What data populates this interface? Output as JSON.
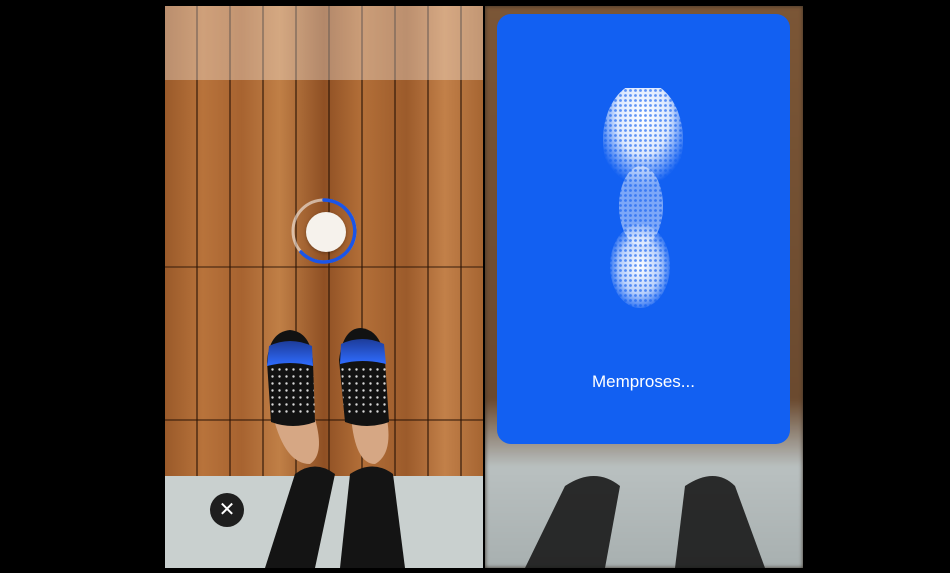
{
  "scan_panel": {
    "status_text": "Memproses...",
    "card_color": "#1260f2"
  },
  "camera_panel": {
    "close_icon_glyph": "✕",
    "progress_ring_color": "#1a55e8"
  },
  "icons": [
    "close-icon",
    "capture-indicator",
    "foot-scan-heatmap"
  ]
}
